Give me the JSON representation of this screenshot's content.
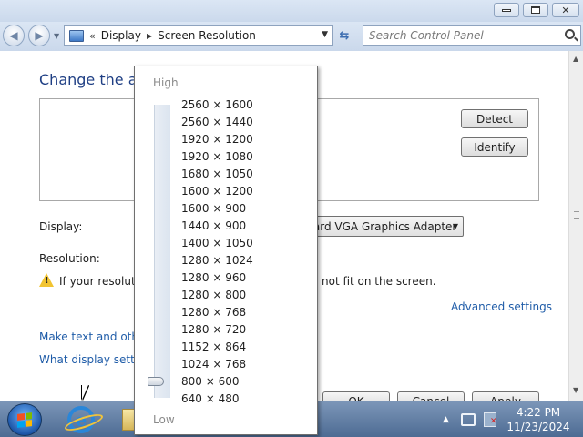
{
  "window": {
    "minimize_icon": "minimize-icon",
    "maximize_icon": "maximize-icon",
    "close_icon": "close-icon"
  },
  "navigation": {
    "breadcrumb": [
      "Display",
      "Screen Resolution"
    ],
    "chevron": "«",
    "search_placeholder": "Search Control Panel"
  },
  "content": {
    "heading": "Change the app",
    "detect_label": "Detect",
    "identify_label": "Identify",
    "display_label": "Display:",
    "display_value": "Standard VGA Graphics Adapter",
    "resolution_label": "Resolution:",
    "warning_text_left": "If your resolutio",
    "warning_text_right": "not fit on the screen.",
    "advanced_settings": "Advanced settings",
    "link_text_size": "Make text and other",
    "link_display_settings": "What display setting",
    "ok_label": "OK",
    "cancel_label": "Cancel",
    "apply_label": "Apply"
  },
  "resolution_popup": {
    "high_label": "High",
    "low_label": "Low",
    "options": [
      "2560 × 1600",
      "2560 × 1440",
      "1920 × 1200",
      "1920 × 1080",
      "1680 × 1050",
      "1600 × 1200",
      "1600 × 900",
      "1440 × 900",
      "1400 × 1050",
      "1280 × 1024",
      "1280 × 960",
      "1280 × 800",
      "1280 × 768",
      "1280 × 720",
      "1152 × 864",
      "1024 × 768",
      "800 × 600",
      "640 × 480"
    ],
    "selected": "800 × 600"
  },
  "taskbar": {
    "time": "4:22 PM",
    "date": "11/23/2024"
  },
  "colors": {
    "heading": "#1f3f84",
    "link": "#1f5ca8",
    "taskbar": "#5b7aa3",
    "warning": "#f2c431"
  }
}
